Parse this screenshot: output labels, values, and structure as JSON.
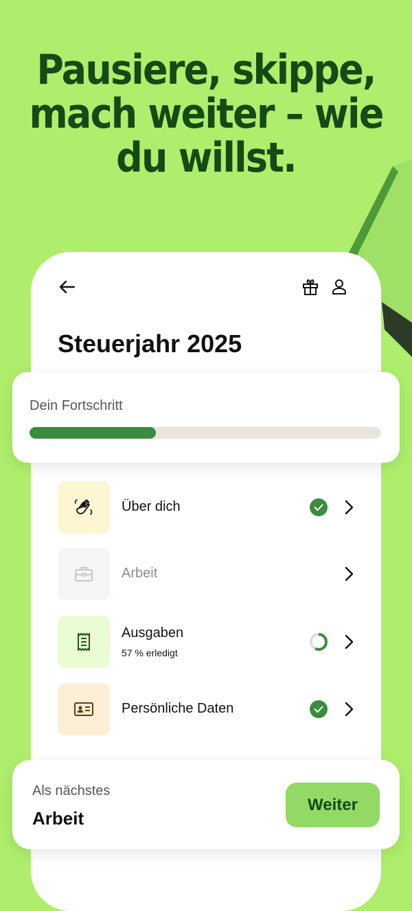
{
  "headline": {
    "line1": "Pausiere, skippe,",
    "line2": "mach weiter – wie",
    "line3": "du willst."
  },
  "header": {
    "back_icon": "arrow-left-icon",
    "gift_icon": "gift-icon",
    "user_icon": "user-icon"
  },
  "page_title": "Steuerjahr 2025",
  "progress": {
    "label": "Dein Fortschritt",
    "fraction": 0.36
  },
  "tasks": [
    {
      "title": "Über dich",
      "subtitle": "",
      "icon": "waving-hand-icon",
      "status": "done",
      "icon_bg": "#fcf7d2"
    },
    {
      "title": "Arbeit",
      "subtitle": "",
      "icon": "briefcase-icon",
      "status": "none",
      "icon_bg": "#f6f5f3"
    },
    {
      "title": "Ausgaben",
      "subtitle": "57 % erledigt",
      "icon": "receipt-icon",
      "status": "partial",
      "partial_fraction": 0.57,
      "icon_bg": "#e9fcd2"
    },
    {
      "title": "Persönliche Daten",
      "subtitle": "",
      "icon": "id-card-icon",
      "status": "done",
      "icon_bg": "#fdeed6"
    }
  ],
  "next": {
    "label": "Als nächstes",
    "value": "Arbeit",
    "button_label": "Weiter"
  },
  "colors": {
    "background": "#aeee6c",
    "headline": "#134a16",
    "progress_fill": "#3b8c3e",
    "progress_track": "#ece5dc",
    "button": "#93d966",
    "check": "#3b8c3e"
  }
}
